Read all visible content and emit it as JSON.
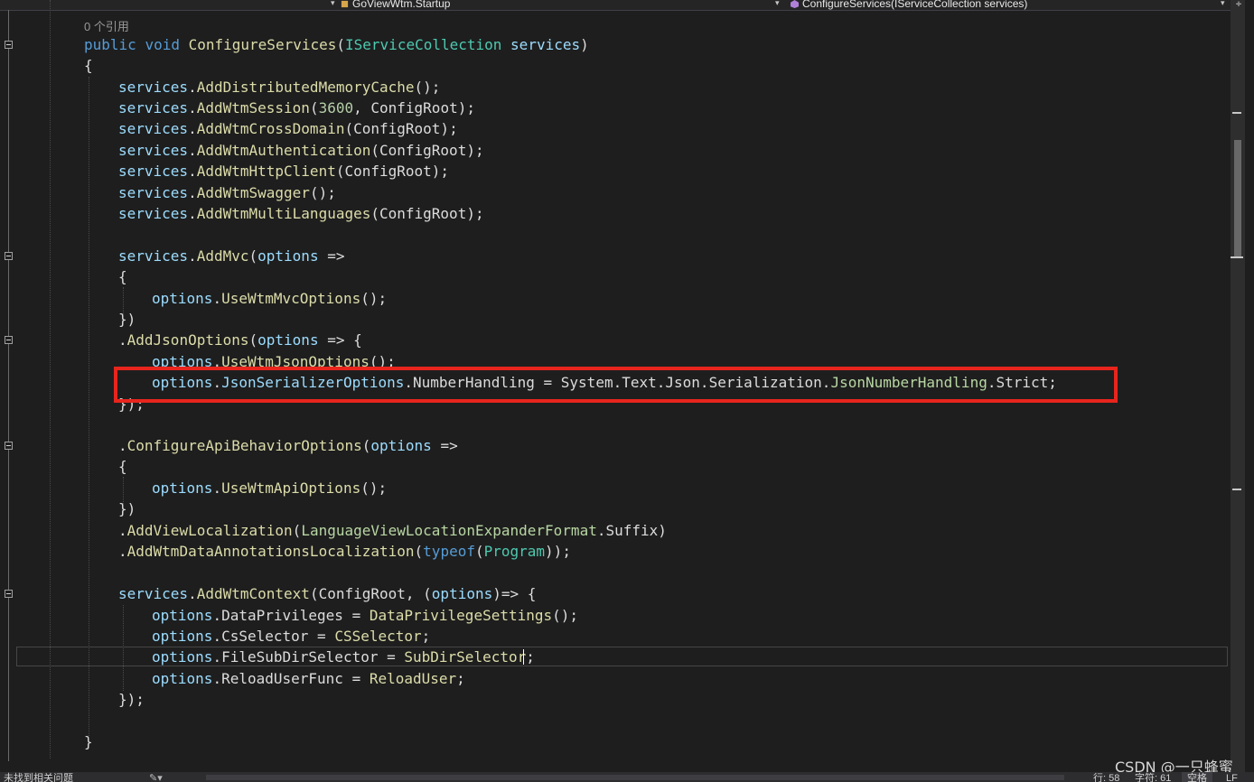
{
  "navbar": {
    "class_dropdown": "GoViewWtm.Startup",
    "member_dropdown": "ConfigureServices(IServiceCollection services)",
    "nav_arrow": "▾"
  },
  "code": {
    "reference_count": "0 个引用",
    "lines": {
      "l1": {
        "a": "public",
        "b": " ",
        "c": "void",
        "d": " ",
        "e": "ConfigureServices",
        "f": "(",
        "g": "IServiceCollection",
        "h": " ",
        "i": "services",
        "j": ")"
      },
      "l2": {
        "a": "{"
      },
      "l3": {
        "a": "services",
        ".": ".",
        "b": "AddDistributedMemoryCache",
        "c": "();"
      },
      "l4": {
        "a": "services",
        ".": ".",
        "b": "AddWtmSession",
        "c": "(",
        "d": "3600",
        "e": ", ConfigRoot);"
      },
      "l5": {
        "a": "services",
        ".": ".",
        "b": "AddWtmCrossDomain",
        "c": "(ConfigRoot);"
      },
      "l6": {
        "a": "services",
        ".": ".",
        "b": "AddWtmAuthentication",
        "c": "(ConfigRoot);"
      },
      "l7": {
        "a": "services",
        ".": ".",
        "b": "AddWtmHttpClient",
        "c": "(ConfigRoot);"
      },
      "l8": {
        "a": "services",
        ".": ".",
        "b": "AddWtmSwagger",
        "c": "();"
      },
      "l9": {
        "a": "services",
        ".": ".",
        "b": "AddWtmMultiLanguages",
        "c": "(ConfigRoot);"
      },
      "l10": {
        "a": "services",
        ".": ".",
        "b": "AddMvc",
        "c": "(",
        "d": "options",
        "e": " =>"
      },
      "l11": {
        "a": "{"
      },
      "l12": {
        "a": "options",
        ".": ".",
        "b": "UseWtmMvcOptions",
        "c": "();"
      },
      "l13": {
        "a": "})"
      },
      "l14": {
        "a": ".",
        "b": "AddJsonOptions",
        "c": "(",
        "d": "options",
        "e": " => {"
      },
      "l15": {
        "a": "options",
        ".": ".",
        "b": "UseWtmJsonOptions",
        "c": "();"
      },
      "l16": {
        "a": "options",
        ".": ".",
        "b": "JsonSerializerOptions",
        "c": ".",
        "d": "NumberHandling",
        "e": " = ",
        "f": "System",
        "g": ".",
        "h": "Text",
        "i": ".",
        "j": "Json",
        "k": ".",
        "l": "Serialization",
        "m": ".",
        "n": "JsonNumberHandling",
        "o": ".",
        "p": "Strict",
        "q": ";"
      },
      "l17": {
        "a": "});"
      },
      "l18": {
        "a": ".",
        "b": "ConfigureApiBehaviorOptions",
        "c": "(",
        "d": "options",
        "e": " =>"
      },
      "l19": {
        "a": "{"
      },
      "l20": {
        "a": "options",
        ".": ".",
        "b": "UseWtmApiOptions",
        "c": "();"
      },
      "l21": {
        "a": "})"
      },
      "l22": {
        "a": ".",
        "b": "AddViewLocalization",
        "c": "(",
        "d": "LanguageViewLocationExpanderFormat",
        "e": ".",
        "f": "Suffix",
        "g": ")"
      },
      "l23": {
        "a": ".",
        "b": "AddWtmDataAnnotationsLocalization",
        "c": "(",
        "d": "typeof",
        "e": "(",
        "f": "Program",
        "g": "));"
      },
      "l24": {
        "a": "services",
        ".": ".",
        "b": "AddWtmContext",
        "c": "(ConfigRoot, (",
        "d": "options",
        "e": ")=> {"
      },
      "l25": {
        "a": "options",
        ".": ".",
        "b": "DataPrivileges",
        "c": " = ",
        "d": "DataPrivilegeSettings",
        "e": "();"
      },
      "l26": {
        "a": "options",
        ".": ".",
        "b": "CsSelector",
        "c": " = ",
        "d": "CSSelector",
        "e": ";"
      },
      "l27": {
        "a": "options",
        ".": ".",
        "b": "FileSubDirSelector",
        "c": " = ",
        "d": "SubDirSelector",
        "e": ";"
      },
      "l28": {
        "a": "options",
        ".": ".",
        "b": "ReloadUserFunc",
        "c": " = ",
        "d": "ReloadUser",
        "e": ";"
      },
      "l29": {
        "a": "});"
      },
      "l30": {
        "a": "}"
      }
    }
  },
  "statusbar": {
    "issues": "未找到相关问题",
    "line": "行: 58",
    "char": "字符: 61",
    "whitespace": "空格",
    "line_ending": "LF"
  },
  "watermark": "CSDN @一只蜂蜜",
  "colors": {
    "background": "#1e1e1e",
    "keyword": "#569cd6",
    "method": "#dcdcaa",
    "variable": "#9cdcfe",
    "type": "#4ec9b0",
    "number": "#b5cea8",
    "highlight_box": "#e8251d"
  }
}
